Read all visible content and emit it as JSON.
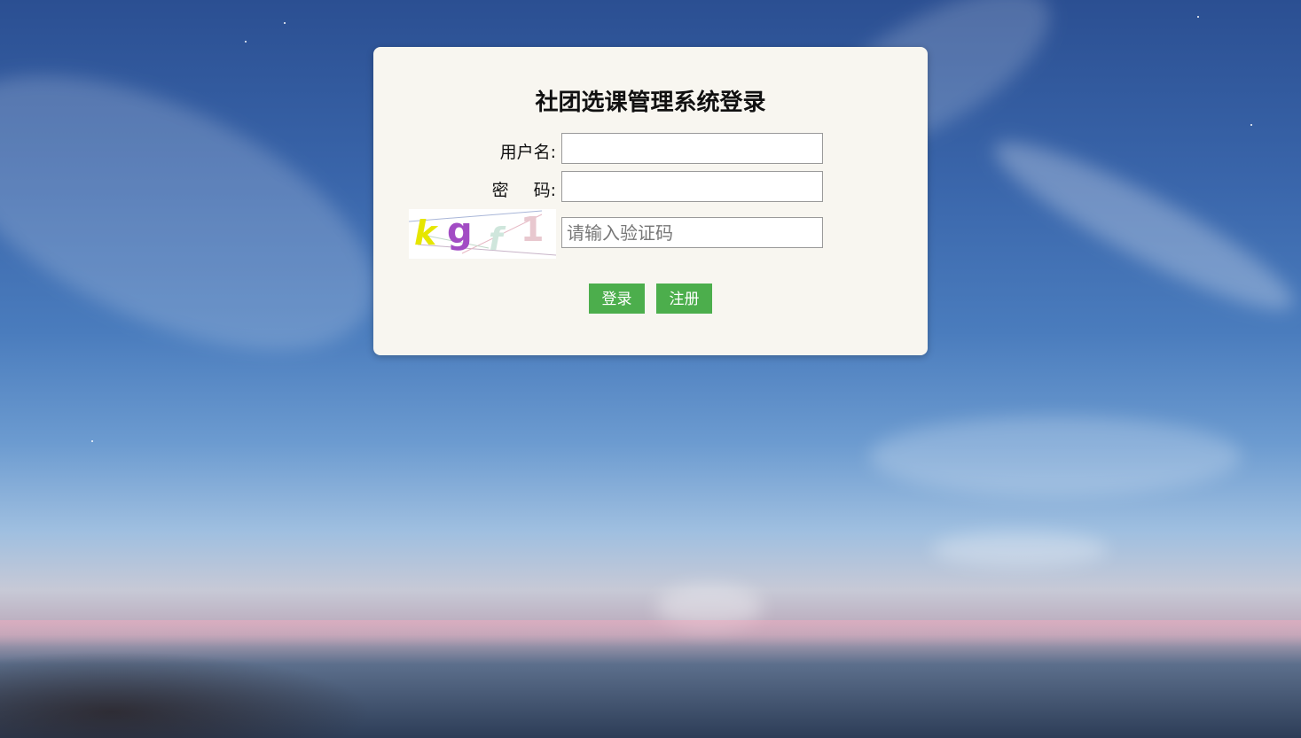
{
  "title": "社团选课管理系统登录",
  "form": {
    "username_label": "用户名:",
    "password_label_left": "密",
    "password_label_right": "码:",
    "username_value": "",
    "password_value": "",
    "captcha_placeholder": "请输入验证码",
    "captcha_chars": [
      "k",
      "g",
      "f",
      "1"
    ],
    "captcha_colors": [
      "#e6e600",
      "#a24cc4",
      "#cfe6dc",
      "#e8c8cf"
    ]
  },
  "buttons": {
    "login": "登录",
    "register": "注册"
  },
  "colors": {
    "panel_bg": "#f8f6f0",
    "button_bg": "#4cae4c"
  }
}
